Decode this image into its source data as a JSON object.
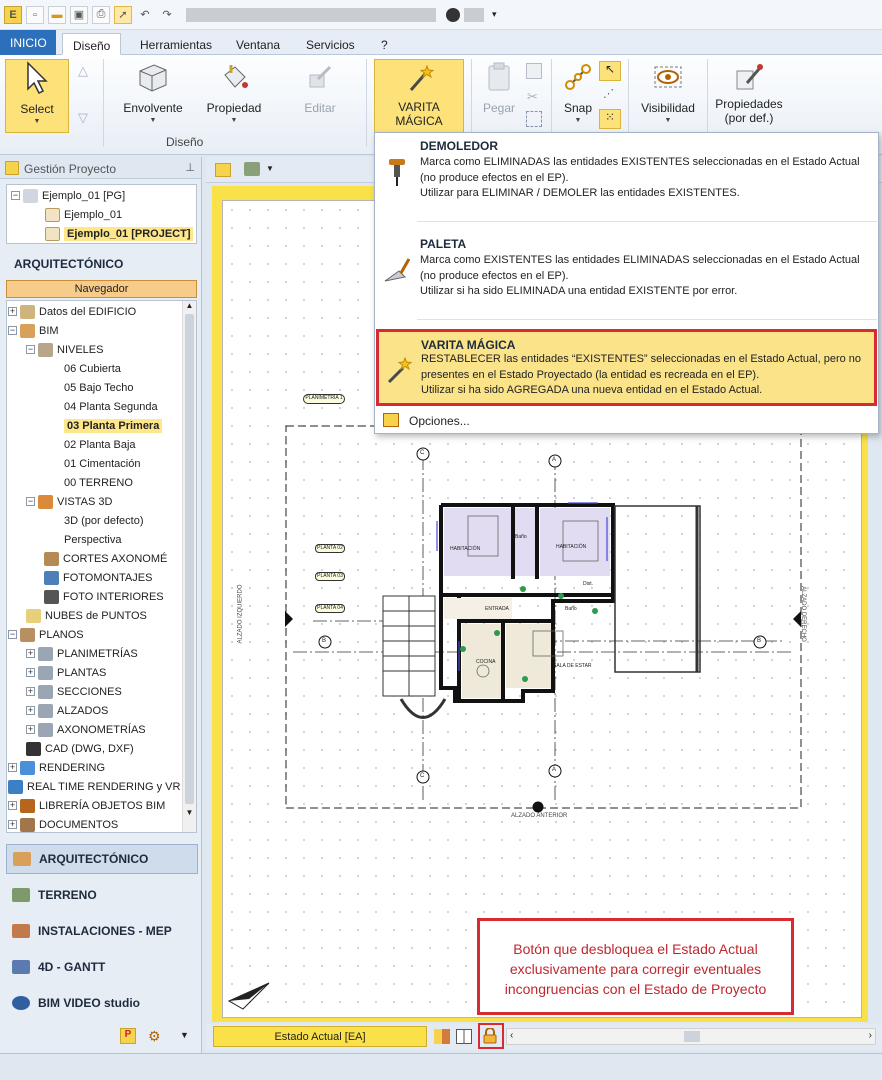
{
  "ribbon_tabs": [
    "INICIO",
    "Diseño",
    "Herramientas",
    "Ventana",
    "Servicios",
    "?"
  ],
  "ribbon": {
    "select": "Select",
    "envolvente": "Envolvente",
    "propiedad": "Propiedad",
    "editar": "Editar",
    "varita_line1": "VARITA",
    "varita_line2": "MÁGICA",
    "pegar": "Pegar",
    "snap": "Snap",
    "visibilidad": "Visibilidad",
    "propiedades_line1": "Propiedades",
    "propiedades_line2": "(por def.)",
    "group_diseno": "Diseño"
  },
  "panel": {
    "title": "Gestión Proyecto",
    "pin_icon": "pin-icon",
    "project_tree": [
      "Ejemplo_01 [PG]",
      "Ejemplo_01",
      "Ejemplo_01 [PROJECT]"
    ],
    "section_heading": "ARQUITECTÓNICO",
    "navigator": "Navegador",
    "nav_tree": [
      "Datos del EDIFICIO",
      "BIM",
      "NIVELES",
      "06 Cubierta",
      "05 Bajo Techo",
      "04 Planta Segunda",
      "03 Planta Primera",
      "02 Planta Baja",
      "01 Cimentación",
      "00 TERRENO",
      "VISTAS 3D",
      "3D (por defecto)",
      "Perspectiva",
      "CORTES AXONOMÉ",
      "FOTOMONTAJES",
      "FOTO INTERIORES",
      "NUBES de PUNTOS",
      "PLANOS",
      "PLANIMETRÍAS",
      "PLANTAS",
      "SECCIONES",
      "ALZADOS",
      "AXONOMETRÍAS",
      "CAD (DWG, DXF)",
      "RENDERING",
      "REAL TIME RENDERING y VR",
      "LIBRERÍA OBJETOS BIM",
      "DOCUMENTOS"
    ],
    "sections": [
      "ARQUITECTÓNICO",
      "TERRENO",
      "INSTALACIONES - MEP",
      "4D - GANTT",
      "BIM VIDEO studio"
    ]
  },
  "menu": {
    "items": [
      {
        "title": "DEMOLEDOR",
        "lines": [
          "Marca como ELIMINADAS las entidades EXISTENTES seleccionadas en el Estado Actual",
          "(no produce efectos en el EP).",
          "Utilizar para ELIMINAR / DEMOLER las entidades EXISTENTES."
        ]
      },
      {
        "title": "PALETA",
        "lines": [
          "Marca como EXISTENTES las entidades ELIMINADAS seleccionadas en el Estado Actual",
          "(no produce efectos en el EP).",
          "Utilizar si ha sido ELIMINADA una entidad EXISTENTE por error."
        ]
      },
      {
        "title": "VARITA MÁGICA",
        "lines": [
          "RESTABLECER las entidades “EXISTENTES” seleccionadas en el Estado Actual, pero no",
          "presentes en el Estado Proyectado (la entidad es recreada en el EP).",
          "Utilizar si ha sido AGREGADA una nueva entidad en el Estado Actual."
        ]
      }
    ],
    "options": "Opciones..."
  },
  "drawing": {
    "plan_labels": [
      "PLANIMETRÍA 1",
      "PLANTA 02",
      "PLANTA 03",
      "PLANTA 04"
    ],
    "rooms": [
      "HABITACIÓN",
      "Baño",
      "HABITACIÓN",
      "Dist.",
      "ENTRADA",
      "Baño",
      "COCINA",
      "SALA DE ESTAR"
    ],
    "alzado_left": "ALZADO IZQUIERDO",
    "alzado_right": "ALZADO DERECHO",
    "alzado_bottom": "ALZADO ANTERIOR",
    "markers": [
      "C",
      "A",
      "B",
      "B",
      "C",
      "A"
    ]
  },
  "status": {
    "estado": "Estado Actual  [EA]"
  },
  "callout": {
    "line1": "Botón que desbloquea el Estado Actual",
    "line2": "exclusivamente para corregir eventuales",
    "line3": "incongruencias con el Estado de Proyecto"
  },
  "colors": {
    "accent_yellow": "#fae14a",
    "highlight_red": "#d72b31",
    "ribbon_blue": "#2c6fbb"
  }
}
